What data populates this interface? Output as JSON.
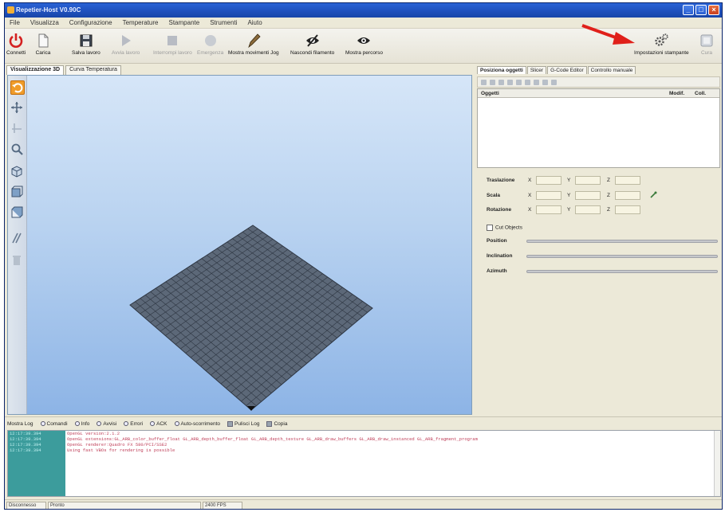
{
  "window": {
    "title": "Repetier-Host V0.90C",
    "buttons": [
      "_",
      "□",
      "×"
    ]
  },
  "menu": [
    "File",
    "Visualizza",
    "Configurazione",
    "Temperature",
    "Stampante",
    "Strumenti",
    "Aiuto"
  ],
  "toolbar": {
    "connect": "Connetti",
    "load": "Carica",
    "save_job": "Salva lavoro",
    "run_job": "Avvia lavoro",
    "stop_job": "Interrompi lavoro",
    "emergency": "Emergenza",
    "show_travel": "Mostra movimenti Jog",
    "hide_filament": "Nascondi filamento",
    "show_path": "Mostra percorso",
    "printer_settings": "Impostazioni stampante",
    "last": "Cura"
  },
  "left_tabs": [
    "Visualizzazione 3D",
    "Curva Temperatura"
  ],
  "right_tabs": [
    "Posiziona oggetti",
    "Slicer",
    "G-Code Editor",
    "Controllo manuale"
  ],
  "objects_table": {
    "columns": [
      "Oggetti",
      "Modif.",
      "Coll."
    ]
  },
  "transform": {
    "rows": [
      "Traslazione",
      "Scala",
      "Rotazione"
    ],
    "axes": [
      "X",
      "Y",
      "Z"
    ]
  },
  "cut": {
    "label": "Cut Objects",
    "sliders": [
      "Position",
      "Inclination",
      "Azimuth"
    ]
  },
  "log": {
    "buttons": [
      "Mostra Log",
      "Comandi",
      "Info",
      "Avvisi",
      "Errori",
      "ACK",
      "Auto-scorrimento",
      "Pulisci Log",
      "Copia"
    ],
    "times": [
      "12:17:39.394",
      "12:17:39.394",
      "12:17:39.394",
      "12:17:39.394"
    ],
    "lines": [
      "OpenGL version:2.1.2",
      "OpenGL extensions:GL_ARB_color_buffer_float GL_ARB_depth_buffer_float GL_ARB_depth_texture GL_ARB_draw_buffers GL_ARB_draw_instanced GL_ARB_fragment_program",
      "OpenGL renderer:Quadro FX 580/PCI/SSE2",
      "Using fast VBOs for rendering is possible"
    ]
  },
  "status": {
    "disconnected": "Disconnesso",
    "pronto": "Pronto",
    "fps": "2400 FPS"
  },
  "colors": {
    "bed": "#5c6878",
    "bed_grid": "#2e3642",
    "accent_orange": "#f09c2a",
    "arrow_red": "#e0201a"
  }
}
